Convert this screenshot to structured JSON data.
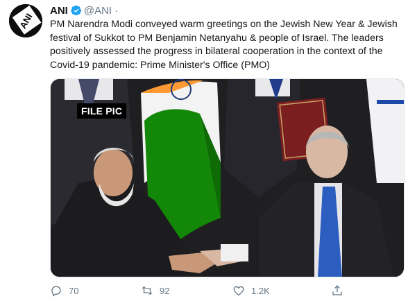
{
  "tweet": {
    "author_name": "ANI",
    "author_handle": "@ANI",
    "separator": "·",
    "avatar_logo_text": "ANI",
    "text": "PM Narendra Modi conveyed warm greetings on the Jewish New Year & Jewish festival of Sukkot to PM Benjamin Netanyahu & people of Israel. The leaders positively assessed the progress in bilateral cooperation in the context of the Covid-19 pandemic: Prime Minister's Office (PMO)",
    "media_caption": "FILE PIC"
  },
  "actions": {
    "reply_count": "70",
    "retweet_count": "92",
    "like_count": "1.2K"
  },
  "colors": {
    "verified_badge": "#1da1f2",
    "secondary_text": "#657786",
    "india_saffron": "#ff9933",
    "india_green": "#138808"
  },
  "icons": [
    "verified-icon",
    "reply-icon",
    "retweet-icon",
    "like-icon",
    "share-icon"
  ]
}
